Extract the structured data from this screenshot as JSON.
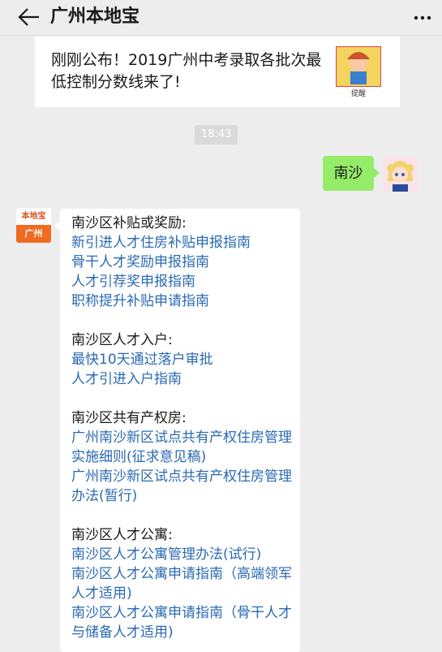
{
  "header": {
    "title": "广州本地宝"
  },
  "link_card": {
    "title": "刚刚公布！2019广州中考录取各批次最低控制分数线来了!",
    "thumb_label": "提醒"
  },
  "time_badge": "18:43",
  "user_message": "南沙",
  "bot_avatar": {
    "top_text": "本地宝",
    "bottom_text": "广州"
  },
  "bot_message": {
    "sections": [
      {
        "title": "南沙区补贴或奖励:",
        "links": [
          "新引进人才住房补贴申报指南",
          "骨干人才奖励申报指南",
          "人才引荐奖申报指南",
          "职称提升补贴申请指南"
        ]
      },
      {
        "title": "南沙区人才入户:",
        "links": [
          "最快10天通过落户审批",
          "人才引进入户指南"
        ]
      },
      {
        "title": "南沙区共有产权房:",
        "links": [
          "广州南沙新区试点共有产权住房管理实施细则(征求意见稿)",
          "广州南沙新区试点共有产权住房管理办法(暂行)"
        ]
      },
      {
        "title": "南沙区人才公寓:",
        "links": [
          "南沙区人才公寓管理办法(试行)",
          "南沙区人才公寓申请指南（高端领军人才适用)",
          "南沙区人才公寓申请指南（骨干人才与储备人才适用)"
        ]
      }
    ]
  },
  "colors": {
    "background": "#ededed",
    "link": "#2a6ab3",
    "user_bubble": "#95ec69",
    "brand_orange": "#f06b20"
  },
  "icons": [
    "back-arrow-icon",
    "more-dots-icon"
  ]
}
